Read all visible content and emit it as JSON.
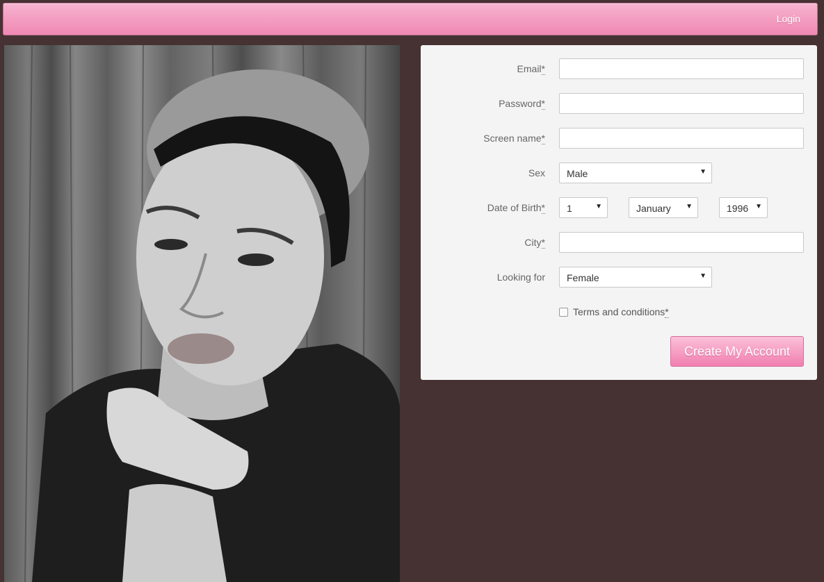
{
  "header": {
    "login_label": "Login"
  },
  "photo": {
    "description_icon": "portrait-photo"
  },
  "form": {
    "email": {
      "label": "Email",
      "required_mark": "*",
      "value": ""
    },
    "password": {
      "label": "Password",
      "required_mark": "*",
      "value": ""
    },
    "screen_name": {
      "label": "Screen name",
      "required_mark": "*",
      "value": ""
    },
    "sex": {
      "label": "Sex",
      "selected": "Male"
    },
    "date_of_birth": {
      "label": "Date of Birth",
      "required_mark": "*",
      "day": "1",
      "month": "January",
      "year": "1996"
    },
    "city": {
      "label": "City",
      "required_mark": "*",
      "value": ""
    },
    "looking_for": {
      "label": "Looking for",
      "selected": "Female"
    },
    "terms": {
      "label": "Terms and conditions",
      "required_mark": "*",
      "checked": false
    },
    "submit_label": "Create My Account"
  },
  "colors": {
    "background": "#463232",
    "accent_pink": "#f088b4",
    "panel": "#f4f4f4"
  }
}
